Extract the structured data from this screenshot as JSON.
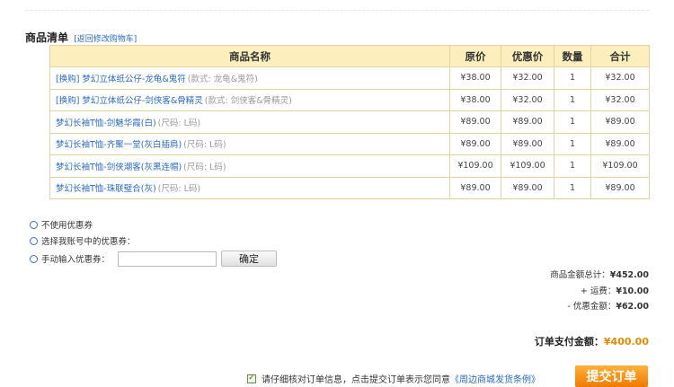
{
  "section": {
    "title": "商品清单",
    "back_link": "[返回修改购物车]"
  },
  "table": {
    "headers": [
      "商品名称",
      "原价",
      "优惠价",
      "数量",
      "合计"
    ],
    "rows": [
      {
        "name": "[换购] 梦幻立体纸公仔-龙龟&鬼符",
        "spec": "(款式: 龙龟&鬼符)",
        "price": "¥38.00",
        "sale": "¥32.00",
        "qty": "1",
        "total": "¥32.00"
      },
      {
        "name": "[换购] 梦幻立体纸公仔-剑侠客&骨精灵",
        "spec": "(款式: 剑侠客&骨精灵)",
        "price": "¥38.00",
        "sale": "¥32.00",
        "qty": "1",
        "total": "¥32.00"
      },
      {
        "name": "梦幻长袖T恤-剑魅华霞(白)",
        "spec": "(尺码: L码)",
        "price": "¥89.00",
        "sale": "¥89.00",
        "qty": "1",
        "total": "¥89.00"
      },
      {
        "name": "梦幻长袖T恤-齐聚一堂(灰白插肩)",
        "spec": "(尺码: L码)",
        "price": "¥89.00",
        "sale": "¥89.00",
        "qty": "1",
        "total": "¥89.00"
      },
      {
        "name": "梦幻长袖T恤-剑侠潮客(灰黑连帽)",
        "spec": "(尺码: L码)",
        "price": "¥109.00",
        "sale": "¥109.00",
        "qty": "1",
        "total": "¥109.00"
      },
      {
        "name": "梦幻长袖T恤-珠联璧合(灰)",
        "spec": "(尺码: L码)",
        "price": "¥89.00",
        "sale": "¥89.00",
        "qty": "1",
        "total": "¥89.00"
      }
    ]
  },
  "coupon": {
    "options": [
      "不使用优惠券",
      "选择我账号中的优惠券：",
      "手动输入优惠券："
    ],
    "input_value": "",
    "confirm_label": "确定"
  },
  "summary": {
    "goods_label": "商品金额总计：",
    "goods_value": "¥452.00",
    "shipping_label": "+ 运费：",
    "shipping_value": "¥10.00",
    "discount_label": "- 优惠金额：",
    "discount_value": "¥62.00",
    "pay_label": "订单支付金额：",
    "pay_value": "¥400.00"
  },
  "agreement": {
    "text": "请仔细核对订单信息，点击提交订单表示您同意",
    "policy_link": "《周边商城发货条例》"
  },
  "submit_label": "提交订单",
  "colors": {
    "link": "#2a6bc2",
    "header_bg": "#fcefbd",
    "accent": "#f07a00"
  }
}
